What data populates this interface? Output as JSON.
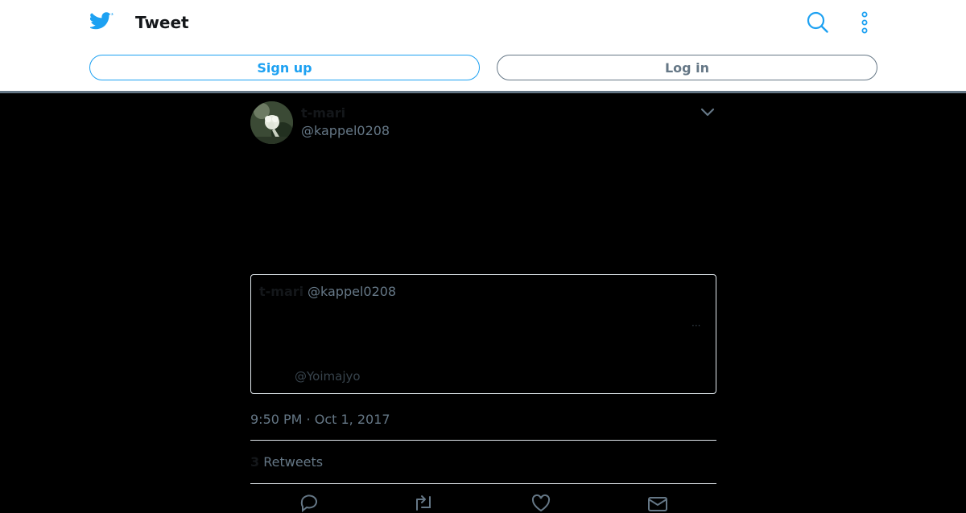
{
  "header": {
    "title": "Tweet",
    "signup_label": "Sign up",
    "login_label": "Log in"
  },
  "tweet": {
    "author_name": "t-mari",
    "author_handle": "@kappel0208",
    "quoted": {
      "author_name": "t-mari",
      "author_handle": "@kappel0208",
      "ellipsis": "···",
      "mention": "@Yoimajyo"
    },
    "timestamp": "9:50 PM · Oct 1, 2017",
    "retweet_count": "3",
    "retweet_label": "Retweets"
  },
  "icons": {
    "logo": "twitter-bird-icon",
    "search": "search-icon",
    "more": "more-vertical-icon",
    "chevron": "chevron-down-icon",
    "reply": "reply-icon",
    "retweet": "retweet-icon",
    "like": "heart-icon",
    "share": "envelope-icon"
  },
  "colors": {
    "accent": "#1da1f2",
    "secondary_text": "#657786",
    "background": "#000000"
  }
}
